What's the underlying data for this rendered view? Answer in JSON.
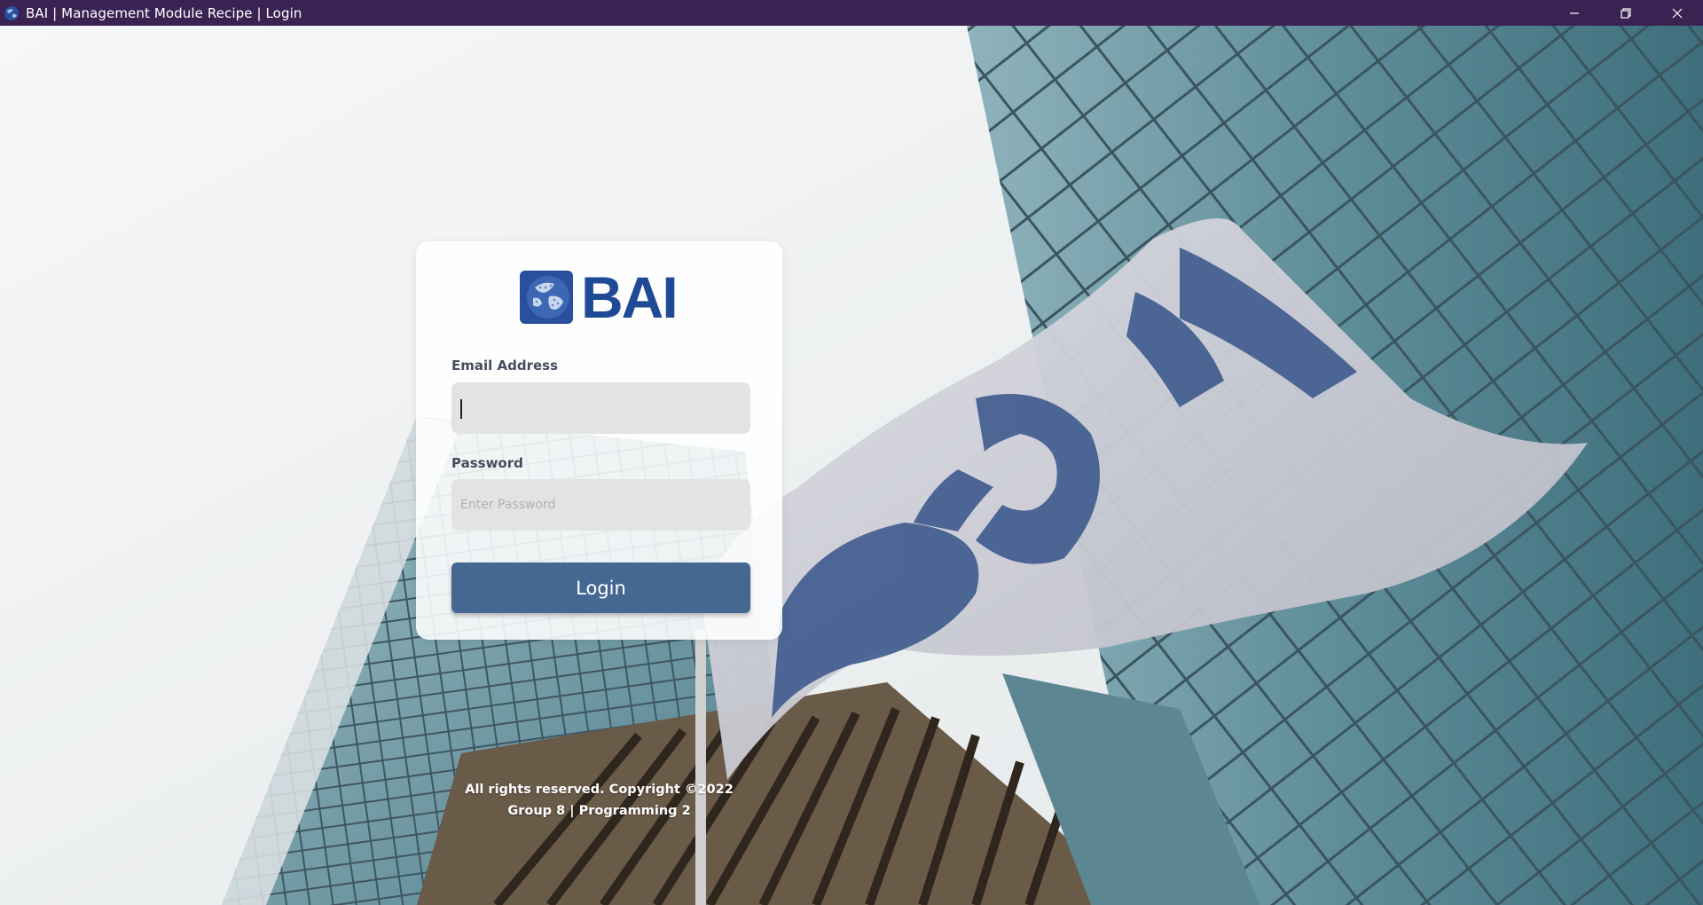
{
  "window": {
    "title": "BAI | Management Module Recipe | Login",
    "controls": [
      "minimize",
      "restore",
      "close"
    ]
  },
  "logo": {
    "text": "BAI",
    "icon": "globe-icon"
  },
  "form": {
    "email_label": "Email Address",
    "email_value": "",
    "email_placeholder": "",
    "password_label": "Password",
    "password_value": "",
    "password_placeholder": "Enter Password",
    "login_label": "Login"
  },
  "footer": {
    "line1": "All rights reserved. Copyright ©2022",
    "line2": "Group 8 | Programming 2"
  },
  "colors": {
    "titlebar": "#3a2353",
    "brand": "#1f4a95",
    "button": "#456893",
    "input_bg": "#e3e3e3"
  }
}
